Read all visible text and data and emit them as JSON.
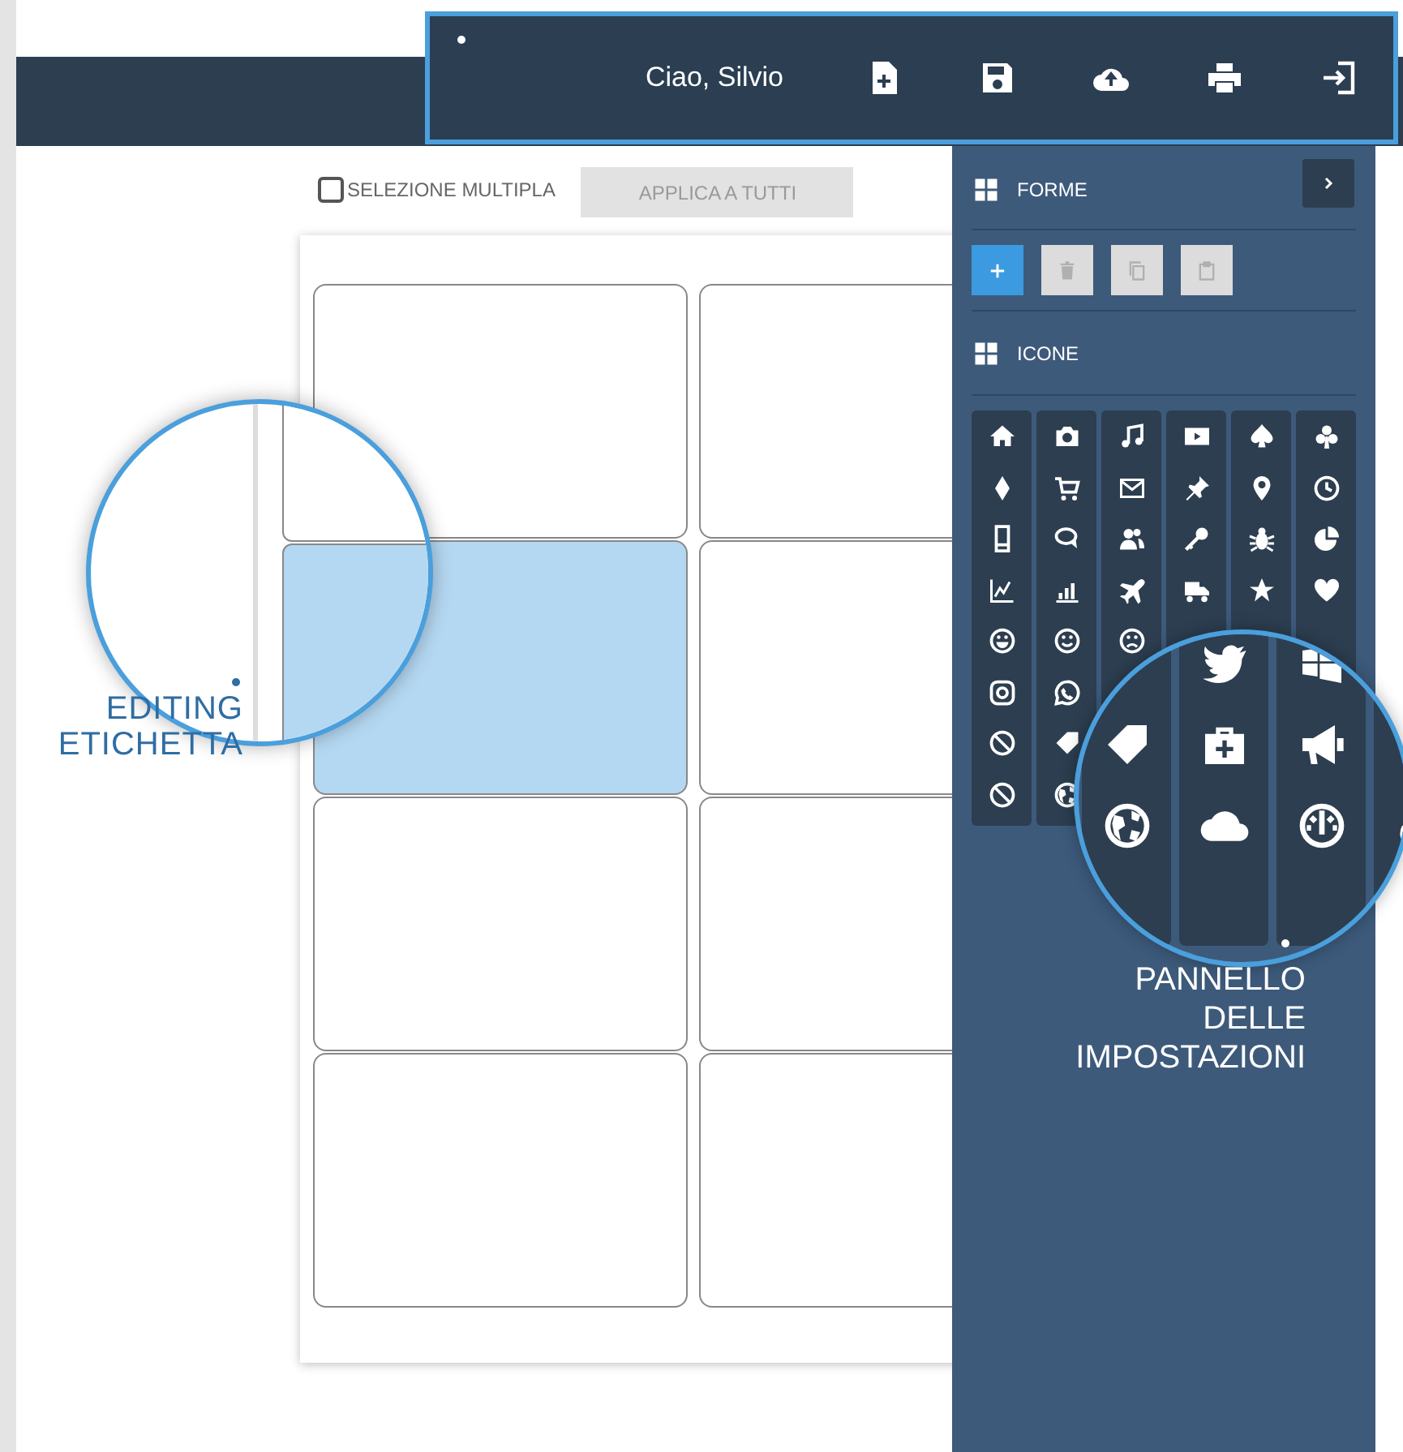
{
  "user_menu": {
    "greeting": "Ciao, Silvio"
  },
  "toolbar": {
    "multi_select": {
      "label": "SELEZIONE MULTIPLA",
      "checked": false
    },
    "apply_button": {
      "label": "APPLICA A TUTTI",
      "disabled": true
    }
  },
  "labels": [
    {
      "selected": false
    },
    {
      "selected": false
    },
    {
      "selected": true
    },
    {
      "selected": false
    },
    {
      "selected": false
    },
    {
      "selected": false
    },
    {
      "selected": false
    },
    {
      "selected": false
    }
  ],
  "panel": {
    "shapes_title": "FORME",
    "shape_buttons": [
      {
        "disabled": false
      },
      {
        "disabled": true
      },
      {
        "disabled": true
      },
      {
        "disabled": true
      }
    ],
    "icons_title": "ICONE"
  },
  "annotations": [
    {
      "text": "EDITING ETICHETTA"
    },
    {
      "text": "PANNELLO DELLE IMPOSTAZIONI"
    }
  ]
}
